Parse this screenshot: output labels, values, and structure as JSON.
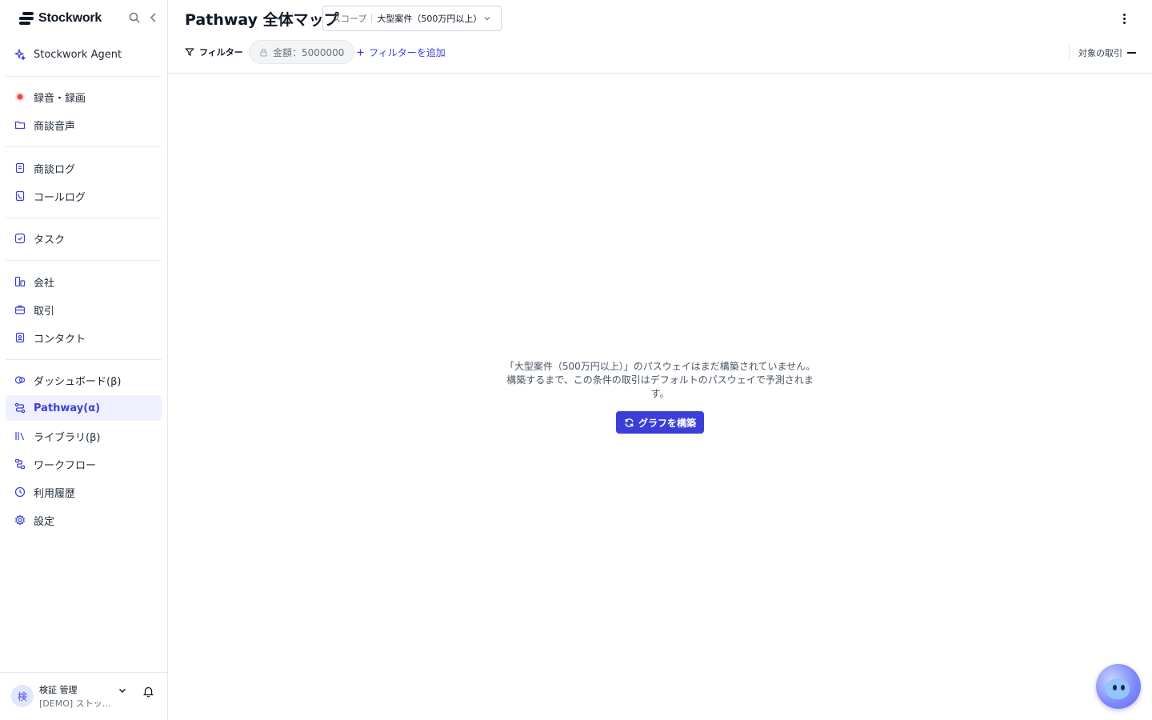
{
  "brand": {
    "name": "Stockwork"
  },
  "sidebar": {
    "agent": {
      "label": "Stockwork Agent"
    },
    "groups": [
      [
        {
          "label": "録音・録画",
          "icon": "record-icon"
        },
        {
          "label": "商談音声",
          "icon": "folder-icon"
        }
      ],
      [
        {
          "label": "商談ログ",
          "icon": "document-icon"
        },
        {
          "label": "コールログ",
          "icon": "phone-icon"
        }
      ],
      [
        {
          "label": "タスク",
          "icon": "check-square-icon"
        }
      ],
      [
        {
          "label": "会社",
          "icon": "building-icon"
        },
        {
          "label": "取引",
          "icon": "briefcase-icon"
        },
        {
          "label": "コンタクト",
          "icon": "contact-icon"
        }
      ],
      [
        {
          "label": "ダッシュボード(β)",
          "icon": "pie-chart-icon"
        },
        {
          "label": "Pathway(α)",
          "icon": "route-icon",
          "active": true
        },
        {
          "label": "ライブラリ(β)",
          "icon": "library-icon"
        },
        {
          "label": "ワークフロー",
          "icon": "workflow-icon"
        },
        {
          "label": "利用履歴",
          "icon": "clock-icon"
        },
        {
          "label": "設定",
          "icon": "gear-icon"
        }
      ]
    ]
  },
  "user": {
    "avatar": "検",
    "name": "検証 管理",
    "org": "[DEMO] ストックマーク"
  },
  "header": {
    "title": "Pathway 全体マップ",
    "scope_label": "スコープ",
    "scope_value": "大型案件（500万円以上）"
  },
  "filters": {
    "filter_label": "フィルター",
    "chip": "金額：5000000",
    "add_label": "フィルターを追加",
    "target_label": "対象の取引"
  },
  "empty_state": {
    "message": "「大型案件（500万円以上）」のパスウェイはまだ構築されていません。 構築するまで、この条件の取引はデフォルトのパスウェイで予測されます。",
    "build_label": "グラフを構築"
  },
  "colors": {
    "accent": "#3b3fd8",
    "active_bg": "#eef0fd",
    "record": "#ef4444"
  }
}
